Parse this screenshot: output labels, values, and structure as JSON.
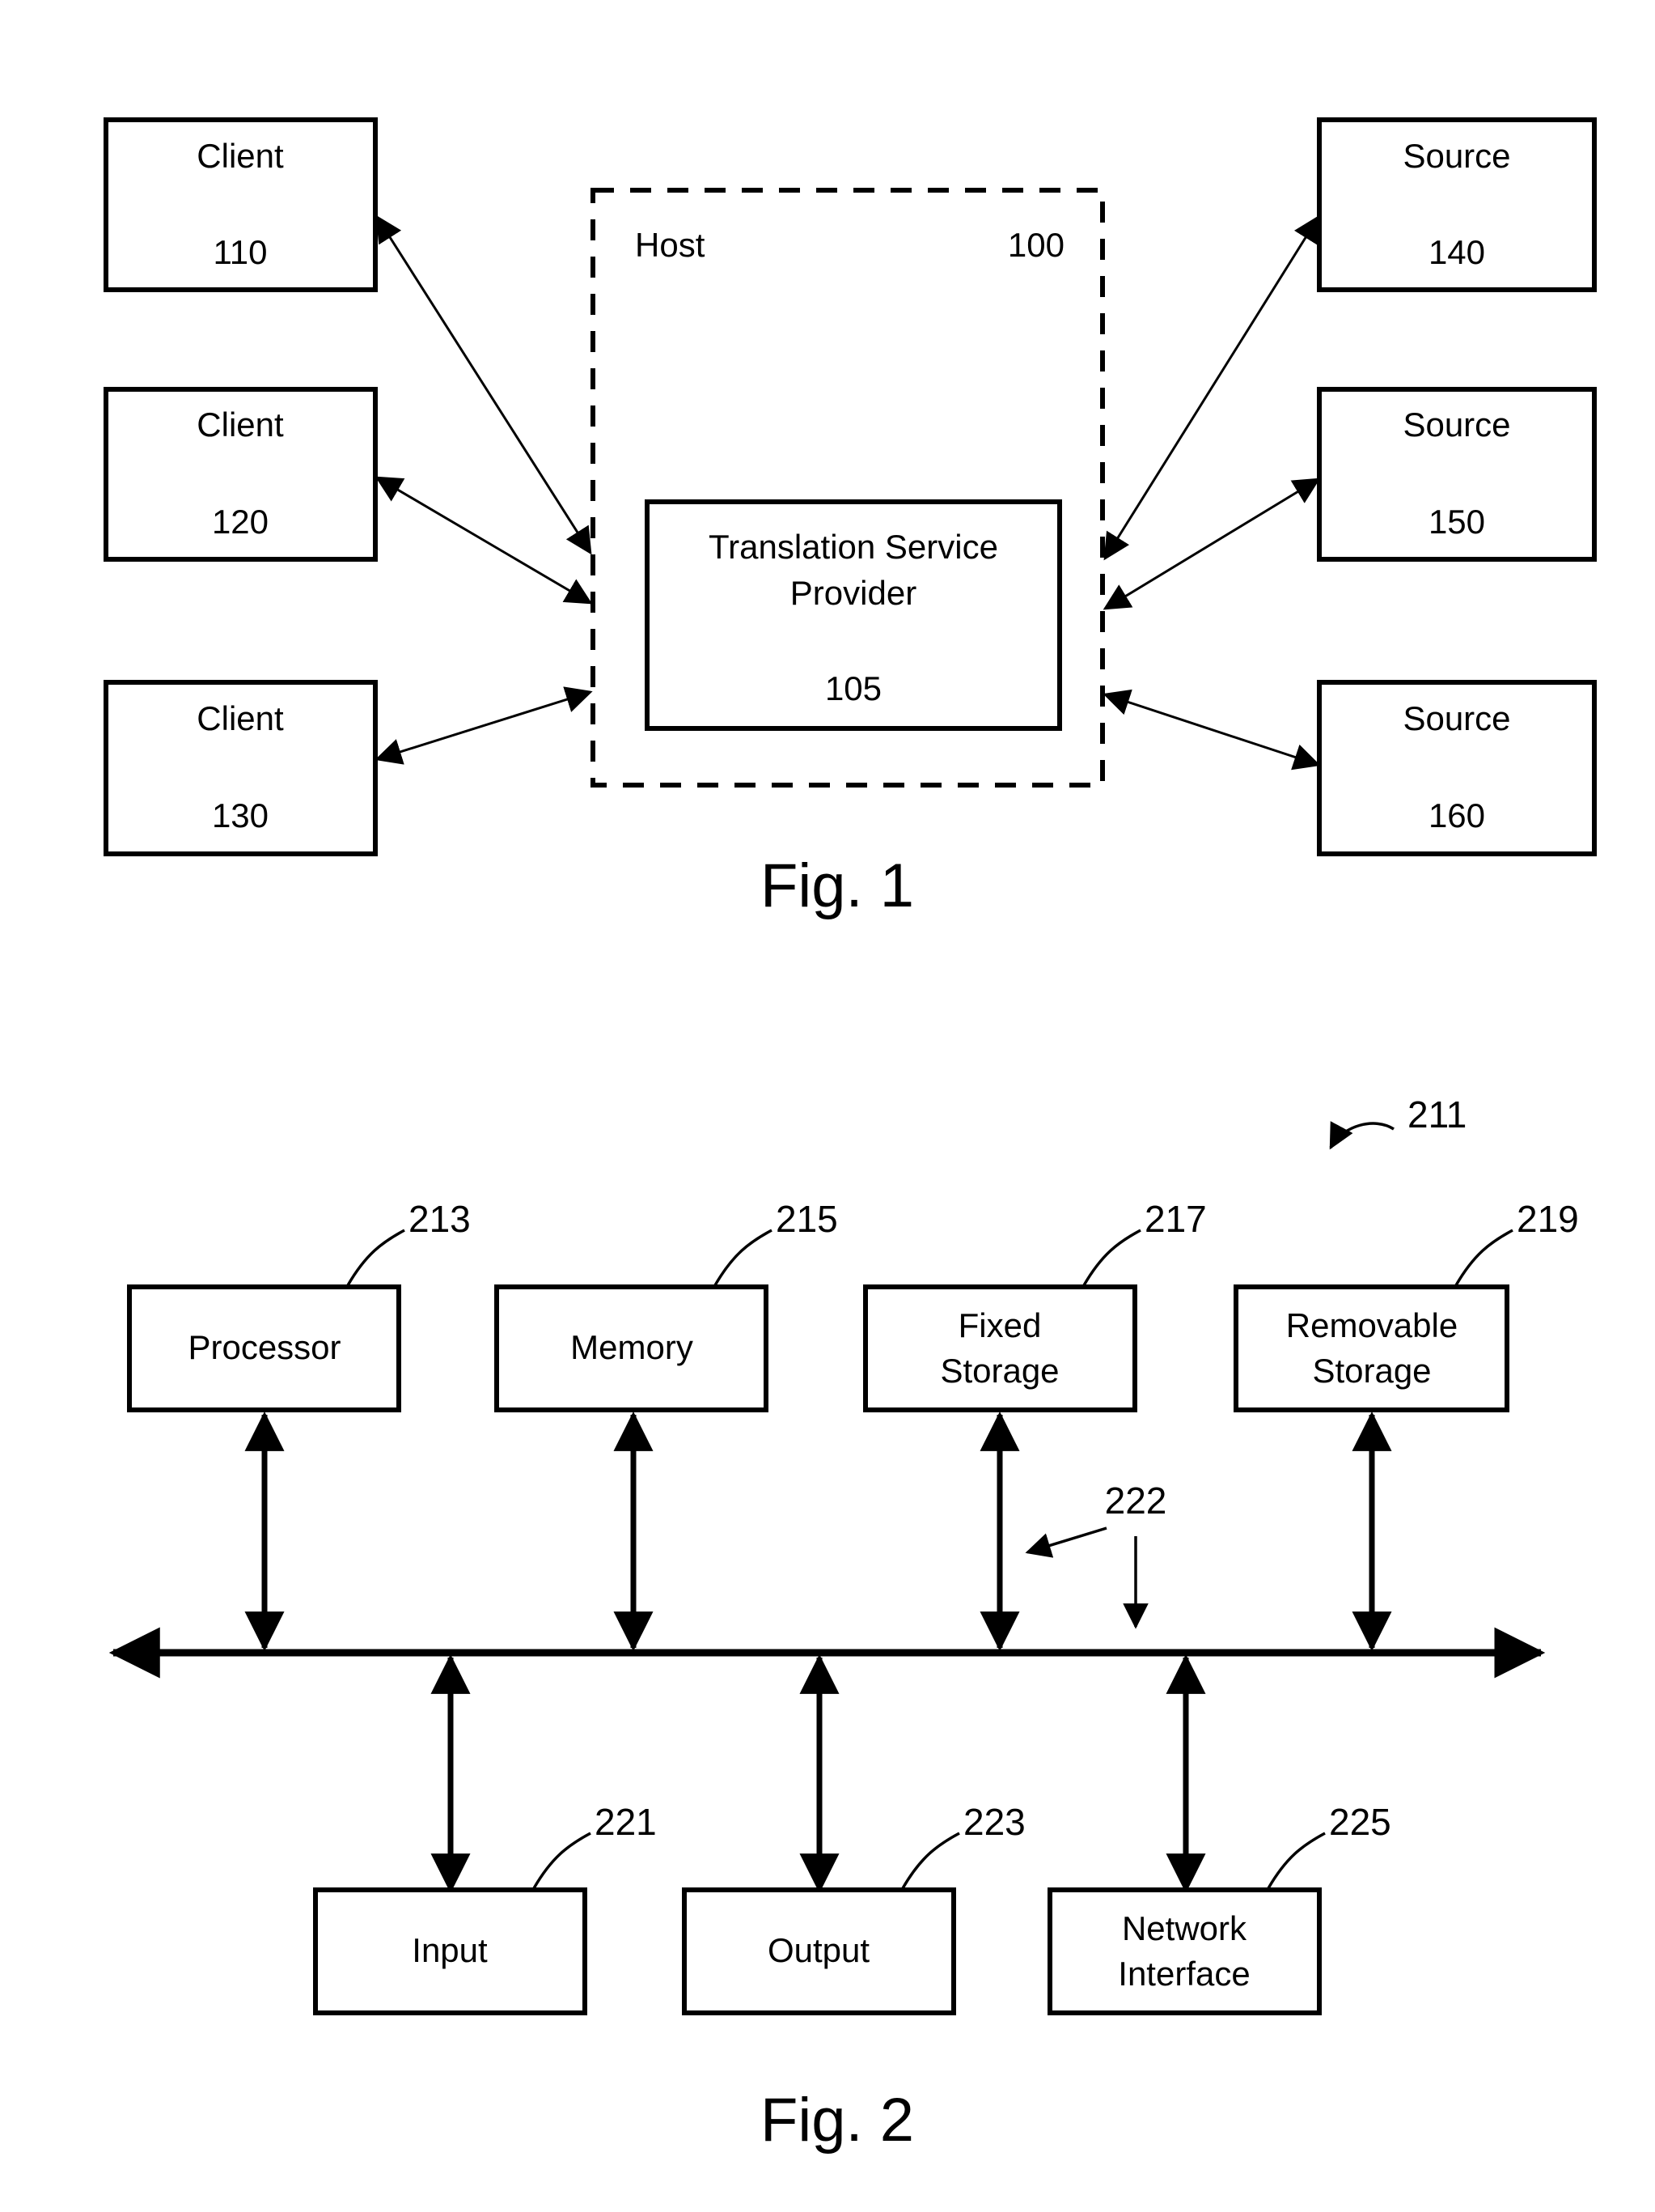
{
  "document": {
    "kind": "patent-figure-sheet",
    "figures": [
      "Fig. 1",
      "Fig. 2"
    ]
  },
  "figure1": {
    "caption": "Fig. 1",
    "host": {
      "label": "Host",
      "ref": "100"
    },
    "translation_service_provider": {
      "line1": "Translation Service",
      "line2": "Provider",
      "ref": "105"
    },
    "clients": [
      {
        "label": "Client",
        "ref": "110"
      },
      {
        "label": "Client",
        "ref": "120"
      },
      {
        "label": "Client",
        "ref": "130"
      }
    ],
    "sources": [
      {
        "label": "Source",
        "ref": "140"
      },
      {
        "label": "Source",
        "ref": "150"
      },
      {
        "label": "Source",
        "ref": "160"
      }
    ]
  },
  "figure2": {
    "caption": "Fig. 2",
    "system_ref": "211",
    "bus_ref": "222",
    "top_components": [
      {
        "label": "Processor",
        "line2": "",
        "ref": "213"
      },
      {
        "label": "Memory",
        "line2": "",
        "ref": "215"
      },
      {
        "label": "Fixed",
        "line2": "Storage",
        "ref": "217"
      },
      {
        "label": "Removable",
        "line2": "Storage",
        "ref": "219"
      }
    ],
    "bottom_components": [
      {
        "label": "Input",
        "line2": "",
        "ref": "221"
      },
      {
        "label": "Output",
        "line2": "",
        "ref": "223"
      },
      {
        "label": "Network",
        "line2": "Interface",
        "ref": "225"
      }
    ]
  }
}
